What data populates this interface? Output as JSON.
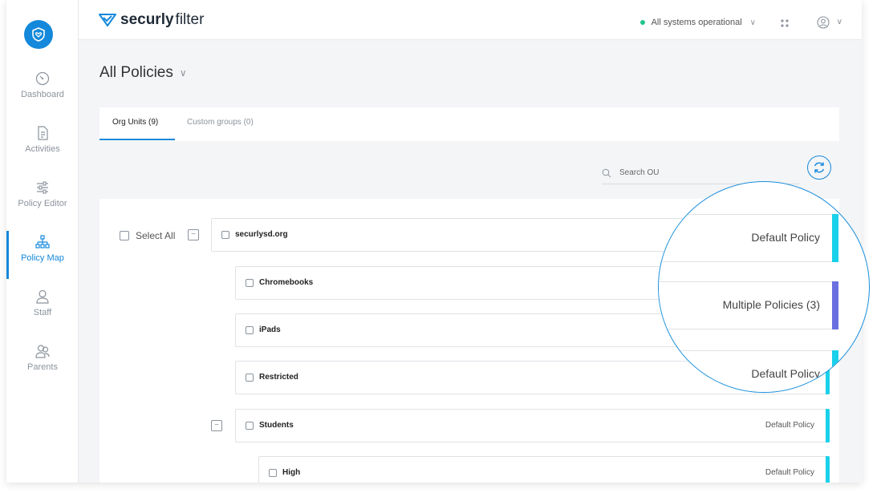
{
  "brand": {
    "bold": "securly",
    "thin": "filter"
  },
  "sidebar": {
    "items": [
      {
        "label": "Dashboard",
        "icon": "dashboard-icon"
      },
      {
        "label": "Activities",
        "icon": "activities-icon"
      },
      {
        "label": "Policy Editor",
        "icon": "policy-editor-icon"
      },
      {
        "label": "Policy Map",
        "icon": "policy-map-icon",
        "active": true
      },
      {
        "label": "Staff",
        "icon": "staff-icon"
      },
      {
        "label": "Parents",
        "icon": "parents-icon"
      }
    ]
  },
  "header": {
    "status": "All systems operational",
    "status_color": "#22c38e"
  },
  "page": {
    "title": "All Policies",
    "tabs": [
      {
        "label": "Org Units (9)",
        "active": true
      },
      {
        "label": "Custom groups (0)",
        "active": false
      }
    ],
    "search_placeholder": "Search OU"
  },
  "tree": {
    "select_all": "Select All",
    "rows": [
      {
        "name": "securlysd.org",
        "policy": ""
      },
      {
        "name": "Chromebooks",
        "policy": ""
      },
      {
        "name": "iPads",
        "policy": ""
      },
      {
        "name": "Restricted",
        "policy": ""
      },
      {
        "name": "Students",
        "policy": "Default Policy"
      },
      {
        "name": "High",
        "policy": "Default Policy"
      }
    ]
  },
  "magnifier": {
    "rows": [
      {
        "policy": "Default Policy",
        "type": "default"
      },
      {
        "policy": "Multiple Policies (3)",
        "type": "multiple"
      },
      {
        "policy": "Default Policy",
        "type": "default"
      }
    ]
  },
  "colors": {
    "accent": "#1488db",
    "default_policy_bar": "#19d1ea",
    "multiple_policy_bar": "#6a6fe0"
  }
}
